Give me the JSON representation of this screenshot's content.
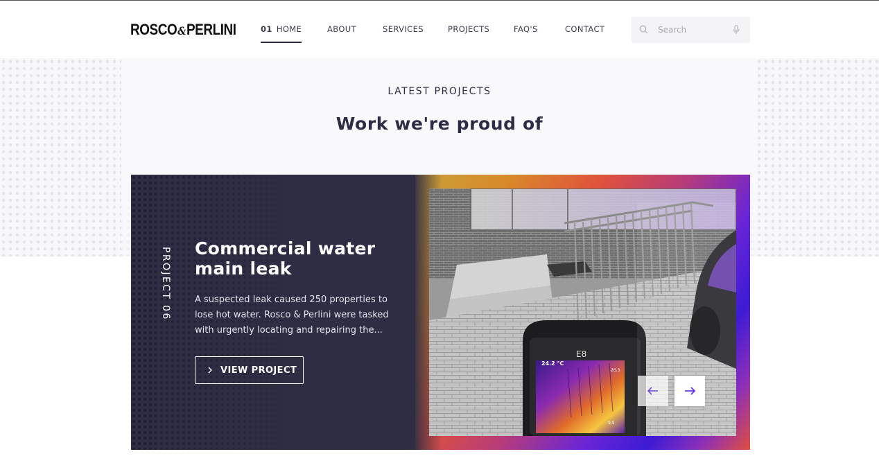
{
  "header": {
    "logo_left": "ROSCO",
    "logo_amp": "&",
    "logo_right": "PERLINI",
    "nav": [
      {
        "num": "01",
        "label": "HOME",
        "active": true
      },
      {
        "label": "ABOUT"
      },
      {
        "label": "SERVICES"
      },
      {
        "label": "PROJECTS"
      },
      {
        "label": "FAQ'S"
      },
      {
        "label": "CONTACT"
      }
    ],
    "search": {
      "placeholder": "Search",
      "icon": "search-icon",
      "mic_icon": "microphone-icon"
    }
  },
  "section": {
    "eyebrow": "LATEST PROJECTS",
    "headline": "Work we're proud of"
  },
  "project": {
    "number_label": "PROJECT 06",
    "title": "Commercial water main leak",
    "description": "A suspected leak caused 250 properties to lose hot water. Rosco & Perlini were tasked with urgently locating and repairing the...",
    "button_label": "VIEW PROJECT",
    "image": {
      "camera_model": "E8",
      "temp_high": "24.2 °C",
      "temp_scale_top": "26.3",
      "temp_scale_bottom": "9.9"
    },
    "prev_icon": "arrow-left-icon",
    "next_icon": "arrow-right-icon"
  },
  "colors": {
    "navy": "#2e2d44",
    "accent_purple": "#5a2be0",
    "gradient_gold": "#c7a23a",
    "gradient_red": "#e0523b",
    "gradient_violet": "#3d1bd4"
  }
}
